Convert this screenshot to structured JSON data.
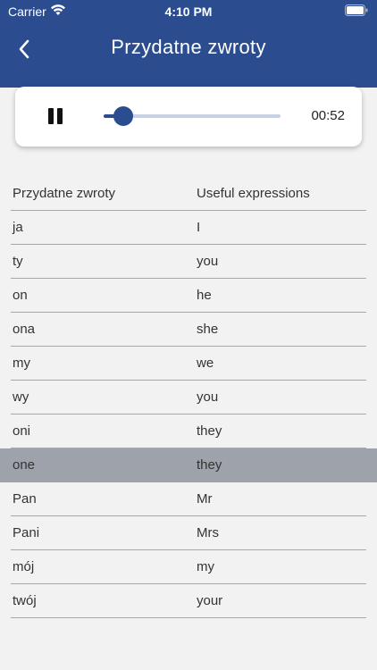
{
  "status_bar": {
    "carrier": "Carrier",
    "time": "4:10 PM"
  },
  "nav": {
    "title": "Przydatne zwroty",
    "back_icon": "chevron-left-icon"
  },
  "player": {
    "state": "playing",
    "control_icon": "pause-icon",
    "progress": 0.11,
    "time": "00:52"
  },
  "table": {
    "headers": [
      "Przydatne zwroty",
      "Useful expressions"
    ],
    "rows": [
      {
        "pl": "ja",
        "en": "I"
      },
      {
        "pl": "ty",
        "en": "you"
      },
      {
        "pl": "on",
        "en": "he"
      },
      {
        "pl": "ona",
        "en": "she"
      },
      {
        "pl": "my",
        "en": "we"
      },
      {
        "pl": "wy",
        "en": "you"
      },
      {
        "pl": "oni",
        "en": "they"
      },
      {
        "pl": "one",
        "en": "they",
        "selected": true
      },
      {
        "pl": "Pan",
        "en": "Mr"
      },
      {
        "pl": "Pani",
        "en": "Mrs"
      },
      {
        "pl": "mój",
        "en": "my"
      },
      {
        "pl": "twój",
        "en": "your"
      }
    ]
  },
  "colors": {
    "primary": "#2b4d8f",
    "track": "#c8d0e3",
    "selected_row": "#9ea2ab",
    "background": "#f2f2f2"
  }
}
